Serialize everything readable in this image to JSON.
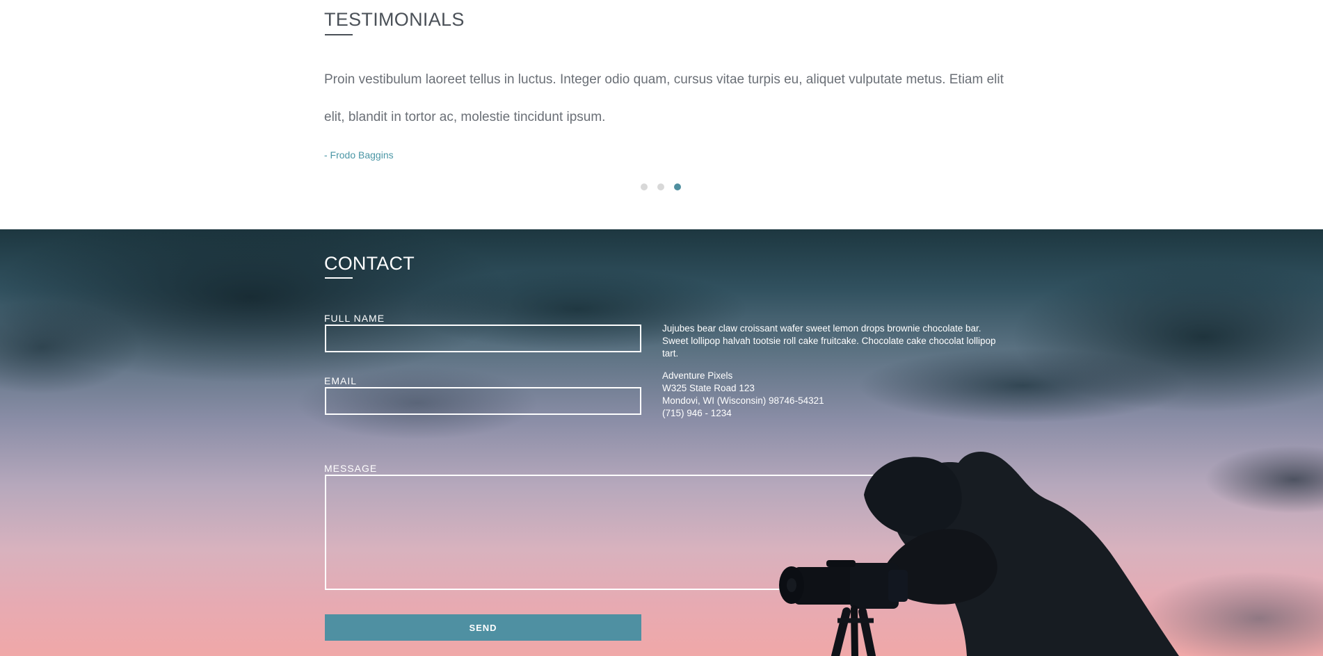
{
  "testimonials": {
    "title": "TESTIMONIALS",
    "quote": "Proin vestibulum laoreet tellus in luctus. Integer odio quam, cursus vitae turpis eu, aliquet vulputate metus. Etiam elit elit, blandit in tortor ac, molestie tincidunt ipsum.",
    "author": "- Frodo Baggins",
    "active_slide": 3,
    "slide_count": 3
  },
  "contact": {
    "title": "CONTACT",
    "full_name_label": "FULL NAME",
    "email_label": "EMAIL",
    "message_label": "MESSAGE",
    "info_text": "Jujubes bear claw croissant wafer sweet lemon drops brownie chocolate bar. Sweet lollipop halvah tootsie roll cake fruitcake. Chocolate cake chocolat lollipop tart.",
    "address": {
      "name": "Adventure Pixels",
      "street": "W325 State Road 123",
      "city_line": "Mondovi, WI (Wisconsin) 98746-54321",
      "phone": "(715) 946 - 1234"
    },
    "send_label": "SEND"
  },
  "colors": {
    "accent": "#4f90a2",
    "author_text": "#4a96a5",
    "active_dot": "#4f8f9f",
    "inactive_dot": "#d8d8d8",
    "title_text": "#4b5158",
    "body_text": "#6a6f76",
    "contact_text": "#ffffff"
  }
}
